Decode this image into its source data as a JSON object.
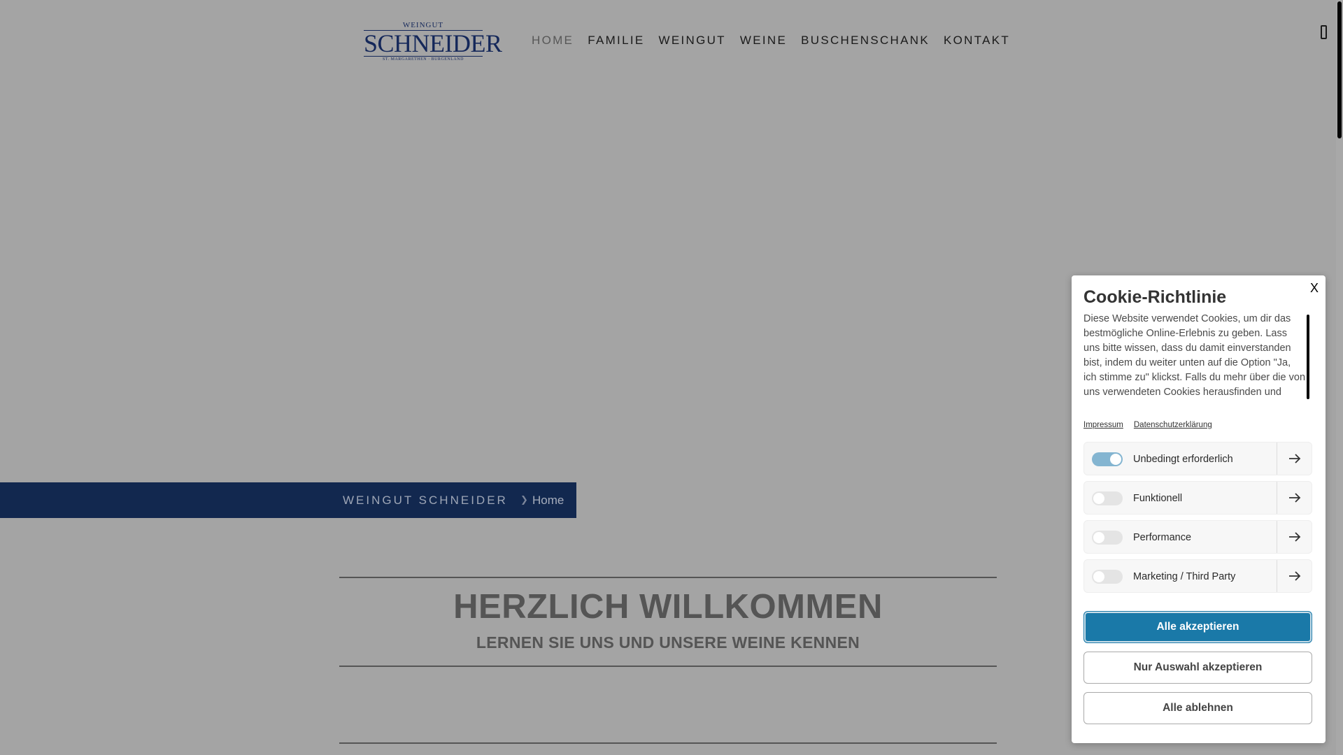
{
  "logo": {
    "top": "WEINGUT",
    "main": "SCHNEIDER",
    "sub": "ST. MARGARETHEN · BURGENLAND"
  },
  "nav": {
    "items": [
      {
        "label": "HOME"
      },
      {
        "label": "FAMILIE"
      },
      {
        "label": "WEINGUT"
      },
      {
        "label": "WEINE"
      },
      {
        "label": "BUSCHENSCHANK"
      },
      {
        "label": "KONTAKT"
      }
    ]
  },
  "breadcrumb": {
    "site": "WEINGUT SCHNEIDER",
    "separator": "❯",
    "current": "Home"
  },
  "welcome": {
    "title": "HERZLICH WILLKOMMEN",
    "subtitle": "LERNEN SIE UNS UND UNSERE WEINE KENNEN"
  },
  "cookie": {
    "close": "X",
    "title": "Cookie-Richtlinie",
    "text": "Diese Website verwendet Cookies, um dir das bestmögliche Online-Erlebnis zu geben. Lass uns bitte wissen, dass du damit einverstanden bist, indem du weiter unten auf die Option \"Ja, ich stimme zu\" klickst. Falls du mehr über die von uns verwendeten Cookies herausfinden und eigene Cookie-Einstellungen verwenden möchtest, schau",
    "links": {
      "impressum": "Impressum",
      "datenschutz": "Datenschutzerklärung"
    },
    "categories": [
      {
        "label": "Unbedingt erforderlich",
        "enabled": true
      },
      {
        "label": "Funktionell",
        "enabled": false
      },
      {
        "label": "Performance",
        "enabled": false
      },
      {
        "label": "Marketing / Third Party",
        "enabled": false
      }
    ],
    "buttons": {
      "accept_all": "Alle akzeptieren",
      "accept_selection": "Nur Auswahl akzeptieren",
      "reject_all": "Alle ablehnen"
    }
  },
  "colors": {
    "brand_navy": "#12284f",
    "accept_blue": "#1a79a8",
    "toggle_on": "#84b5d1"
  },
  "icons": {
    "cat_arrow": "arrow-right-icon",
    "menu": "menu-toggle-icon"
  }
}
